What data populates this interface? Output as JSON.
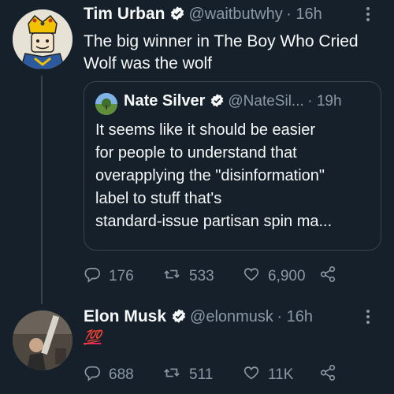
{
  "tweet1": {
    "author_name": "Tim Urban",
    "handle": "@waitbutwhy",
    "time": "· 16h",
    "text_line1": "The big winner in The Boy Who Cried",
    "text_line2": "Wolf was the wolf"
  },
  "quote": {
    "author_name": "Nate Silver",
    "handle": "@NateSil...",
    "time": "· 19h",
    "lines": [
      "It seems like it should be easier",
      "for people to understand that",
      "overapplying the \"disinformation\"",
      "label to stuff that's",
      "standard-issue partisan spin ma..."
    ]
  },
  "tweet1_actions": {
    "replies": "176",
    "retweets": "533",
    "likes": "6,900"
  },
  "tweet2": {
    "author_name": "Elon Musk",
    "handle": "@elonmusk",
    "time": "· 16h",
    "text": "💯"
  },
  "tweet2_actions": {
    "replies": "688",
    "retweets": "511",
    "likes": "11K"
  },
  "colors": {
    "background": "#15202b",
    "muted": "#8b98a5",
    "verified": "#1d9bf0",
    "border": "#38444d"
  },
  "icons": [
    "reply-icon",
    "retweet-icon",
    "like-icon",
    "share-icon",
    "verified-icon",
    "more-icon"
  ]
}
